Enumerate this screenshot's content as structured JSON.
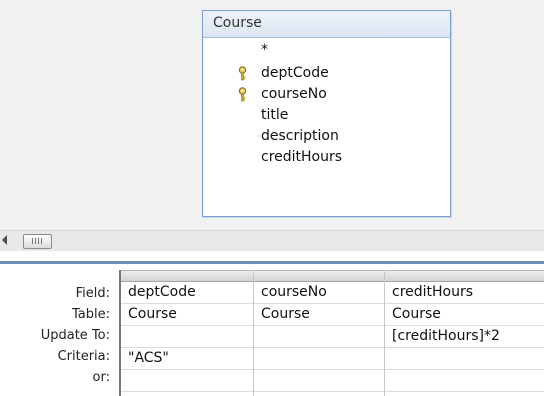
{
  "table": {
    "title": "Course",
    "fields": [
      {
        "name": "*",
        "key": false
      },
      {
        "name": "deptCode",
        "key": true
      },
      {
        "name": "courseNo",
        "key": true
      },
      {
        "name": "title",
        "key": false
      },
      {
        "name": "description",
        "key": false
      },
      {
        "name": "creditHours",
        "key": false
      }
    ]
  },
  "grid": {
    "row_labels": {
      "field": "Field:",
      "table": "Table:",
      "update_to": "Update To:",
      "criteria": "Criteria:",
      "or": "or:"
    },
    "columns": [
      {
        "field": "deptCode",
        "table": "Course",
        "update_to": "",
        "criteria": "\"ACS\"",
        "or": ""
      },
      {
        "field": "courseNo",
        "table": "Course",
        "update_to": "",
        "criteria": "",
        "or": ""
      },
      {
        "field": "creditHours",
        "table": "Course",
        "update_to": "[creditHours]*2",
        "criteria": "",
        "or": ""
      }
    ]
  },
  "colors": {
    "accent": "#7da2ce",
    "splitter": "#6f8fb5",
    "key_icon": "#c9a227"
  },
  "icons": {
    "primary_key": "key-icon",
    "scroll_left": "arrow-left-icon",
    "scroll_thumb": "scroll-thumb-grip-icon"
  }
}
